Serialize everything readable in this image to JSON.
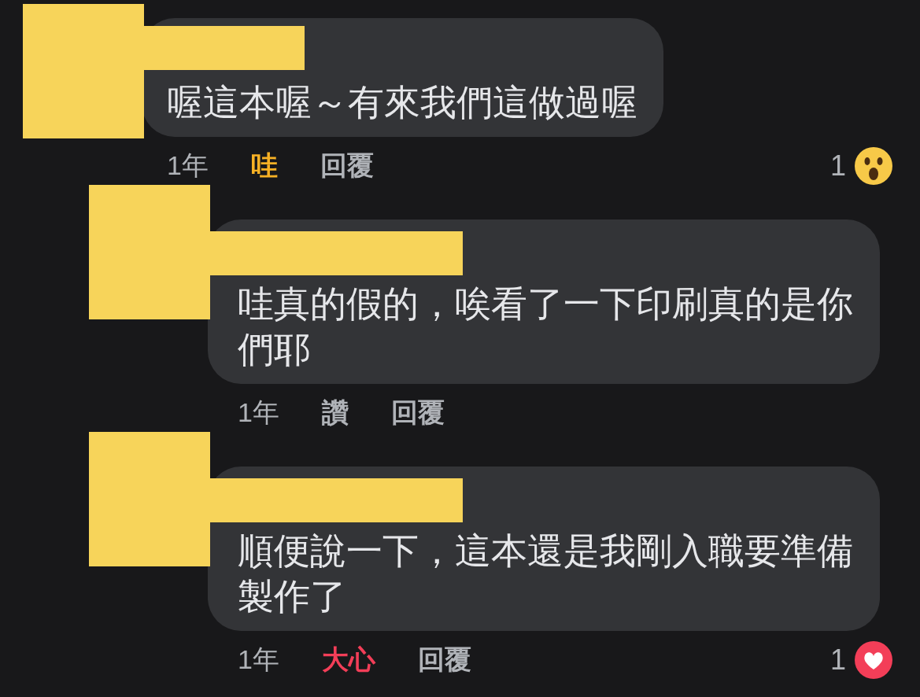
{
  "comments": [
    {
      "redacted": true,
      "text": "喔這本喔～有來我們這做過喔",
      "time": "1年",
      "reaction_button": {
        "label": "哇",
        "kind": "wow"
      },
      "reply": "回覆",
      "reaction_summary": {
        "count": "1",
        "kind": "wow"
      },
      "children": [
        {
          "redacted": true,
          "text": "哇真的假的，唉看了一下印刷真的是你們耶",
          "time": "1年",
          "reaction_button": {
            "label": "讚",
            "kind": "none"
          },
          "reply": "回覆"
        },
        {
          "redacted": true,
          "text": "順便說一下，這本還是我剛入職要準備製作了",
          "time": "1年",
          "reaction_button": {
            "label": "大心",
            "kind": "love"
          },
          "reply": "回覆",
          "reaction_summary": {
            "count": "1",
            "kind": "love"
          }
        }
      ]
    }
  ]
}
